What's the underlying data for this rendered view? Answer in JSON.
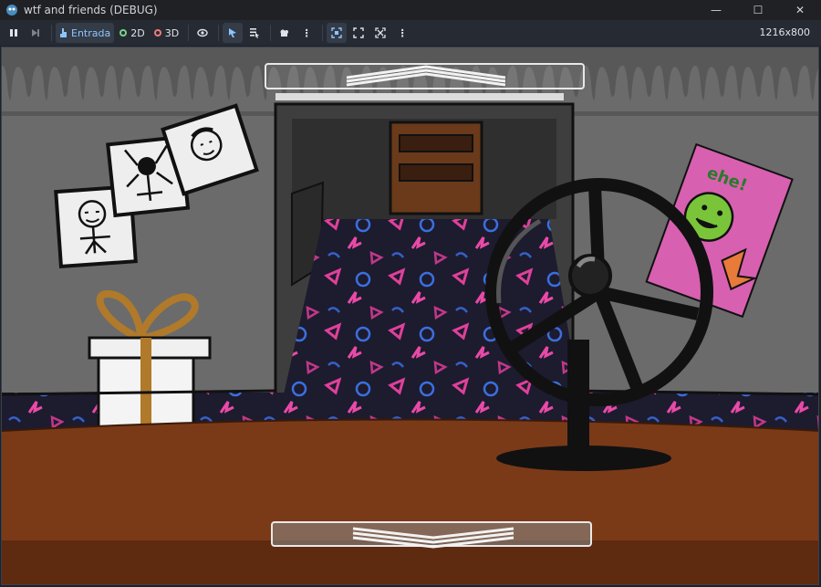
{
  "window": {
    "title": "wtf and friends (DEBUG)",
    "controls": [
      "minimize-icon",
      "maximize-icon",
      "close-icon"
    ]
  },
  "toolbar": {
    "pause_icon": "pause-icon",
    "next_frame_icon": "next-frame-icon",
    "entrada_label": "Entrada",
    "mode_2d_label": "2D",
    "mode_3d_label": "3D",
    "resolution": "1216x800"
  },
  "colors": {
    "accent": "#8ec5ff",
    "mode_2d_dot": "#7ed08a",
    "mode_3d_dot": "#f07a7a",
    "table": "#7a3a18",
    "wall": "#6b6b6b"
  },
  "scene": {
    "nav_top_icon": "chevron-up-icon",
    "nav_bottom_icon": "chevron-down-icon"
  }
}
